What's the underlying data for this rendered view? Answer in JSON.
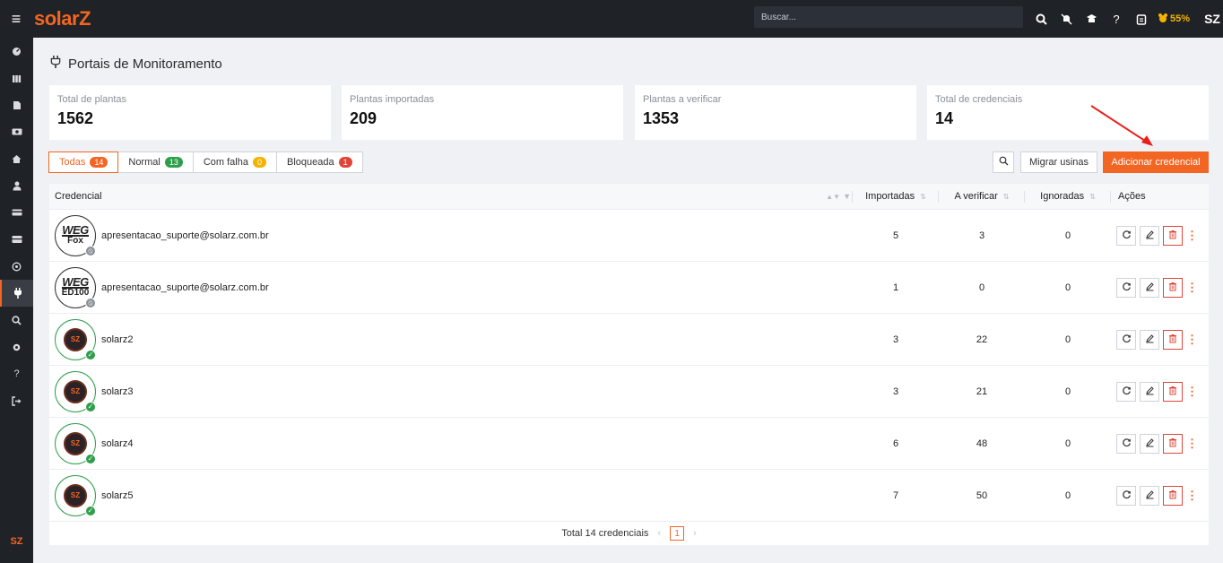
{
  "topbar": {
    "logo": "solarZ",
    "search_placeholder": "Buscar...",
    "battery": "55%",
    "avatar": "SZ"
  },
  "sidebar": {
    "items": [
      "dashboard-icon",
      "library-icon",
      "document-icon",
      "money-icon",
      "home-icon",
      "user-icon",
      "card-icon",
      "wallet-icon",
      "whatsapp-icon",
      "plug-icon",
      "search-icon",
      "gear-icon",
      "help-icon",
      "logout-icon"
    ],
    "active": "plug-icon",
    "footer_logo": "SZ"
  },
  "page": {
    "title": "Portais de Monitoramento"
  },
  "cards": [
    {
      "label": "Total de plantas",
      "value": "1562"
    },
    {
      "label": "Plantas importadas",
      "value": "209"
    },
    {
      "label": "Plantas a verificar",
      "value": "1353"
    },
    {
      "label": "Total de credenciais",
      "value": "14"
    }
  ],
  "tabs": [
    {
      "label": "Todas",
      "count": "14",
      "color": "#f26522"
    },
    {
      "label": "Normal",
      "count": "13",
      "color": "#2e9e4b"
    },
    {
      "label": "Com falha",
      "count": "0",
      "color": "#f5b300"
    },
    {
      "label": "Bloqueada",
      "count": "1",
      "color": "#e0453a"
    }
  ],
  "buttons": {
    "migrar": "Migrar usinas",
    "add": "Adicionar credencial"
  },
  "table": {
    "headers": {
      "credencial": "Credencial",
      "importadas": "Importadas",
      "verificar": "A verificar",
      "ignoradas": "Ignoradas",
      "acoes": "Ações"
    },
    "rows": [
      {
        "name": "apresentacao_suporte@solarz.com.br",
        "logo": "weg",
        "logo_sub": "Fox",
        "importadas": "5",
        "verificar": "3",
        "ignoradas": "0",
        "status": "na"
      },
      {
        "name": "apresentacao_suporte@solarz.com.br",
        "logo": "weg",
        "logo_sub": "ED100",
        "importadas": "1",
        "verificar": "0",
        "ignoradas": "0",
        "status": "na"
      },
      {
        "name": "solarz2",
        "logo": "sz",
        "logo_sub": "",
        "importadas": "3",
        "verificar": "22",
        "ignoradas": "0",
        "status": "ok"
      },
      {
        "name": "solarz3",
        "logo": "sz",
        "logo_sub": "",
        "importadas": "3",
        "verificar": "21",
        "ignoradas": "0",
        "status": "ok"
      },
      {
        "name": "solarz4",
        "logo": "sz",
        "logo_sub": "",
        "importadas": "6",
        "verificar": "48",
        "ignoradas": "0",
        "status": "ok"
      },
      {
        "name": "solarz5",
        "logo": "sz",
        "logo_sub": "",
        "importadas": "7",
        "verificar": "50",
        "ignoradas": "0",
        "status": "ok"
      }
    ]
  },
  "pager": {
    "total": "Total 14 credenciais",
    "current": "1"
  },
  "colors": {
    "accent": "#f26522",
    "dark": "#1f2226",
    "success": "#2e9e4b",
    "danger": "#e0453a",
    "warning": "#f5b300"
  }
}
